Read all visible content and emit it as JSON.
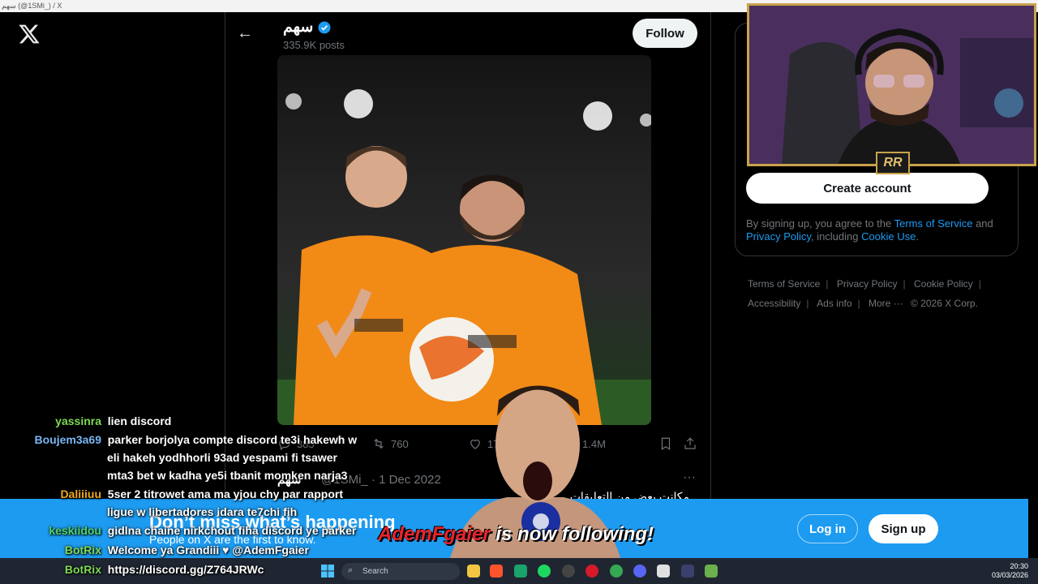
{
  "window": {
    "title": "سهم (@1SMi_) / X"
  },
  "profile": {
    "name": "سهم",
    "posts": "335.9K posts",
    "follow_label": "Follow"
  },
  "tweet": {
    "actions": {
      "replies": "385",
      "reposts": "760",
      "likes": "17K",
      "views": "1.4M"
    }
  },
  "tweet2": {
    "name": "سهم",
    "handle": "@1SMi_",
    "date": "· 1 Dec 2022",
    "more": "···",
    "text": "مكانت بعض من التعليقات"
  },
  "sidebar": {
    "create_account": "Create account",
    "legal": {
      "prefix": "By signing up, you agree to the",
      "tos": "Terms of Service",
      "and": "and",
      "privacy": "Privacy Policy",
      "including": ", including",
      "cookie": "Cookie Use",
      "end": "."
    },
    "footer": [
      "Terms of Service",
      "Privacy Policy",
      "Cookie Policy",
      "Accessibility",
      "Ads info",
      "More ···",
      "© 2026 X Corp."
    ]
  },
  "webcam": {
    "badge": "RR"
  },
  "chat": [
    {
      "user": "yassinra",
      "color": "#7ed957",
      "text": "lien discord"
    },
    {
      "user": "Boujem3a69",
      "color": "#7ab6f5",
      "text": "parker borjolya compte discord te3i hakewh w"
    },
    {
      "user": "",
      "color": "#ffffff",
      "text": "eli hakeh yodhhorli 93ad yespami fi tsawer"
    },
    {
      "user": "",
      "color": "#ffffff",
      "text": "mta3 bet w kadha ye5i tbanit momken narja3"
    },
    {
      "user": "Daliiiuu",
      "color": "#f0a81a",
      "text": "5ser 2 titrowet ama ma yjou chy par rapport"
    },
    {
      "user": "",
      "color": "#ffffff",
      "text": "ligue w libertadores idara te7chi fih"
    },
    {
      "user": "keskiidou",
      "color": "#4fd36b",
      "text": "gidlna chaine nirkchout fiha discord ye parker"
    },
    {
      "user": "BotRix",
      "color": "#7ed957",
      "text": "Welcome ya Grandiii ♥ @AdemFgaier"
    },
    {
      "user": "BotRix",
      "color": "#7ed957",
      "text": "https://discord.gg/Z764JRWc"
    }
  ],
  "banner": {
    "title": "Don’t miss what’s happening",
    "subtitle": "People on X are the first to know.",
    "login": "Log in",
    "signup": "Sign up"
  },
  "alert": {
    "user": "AdemFgaier",
    "text": " is now following!"
  },
  "taskbar": {
    "search": "Search",
    "time": "20:30",
    "date": "03/03/2026"
  }
}
